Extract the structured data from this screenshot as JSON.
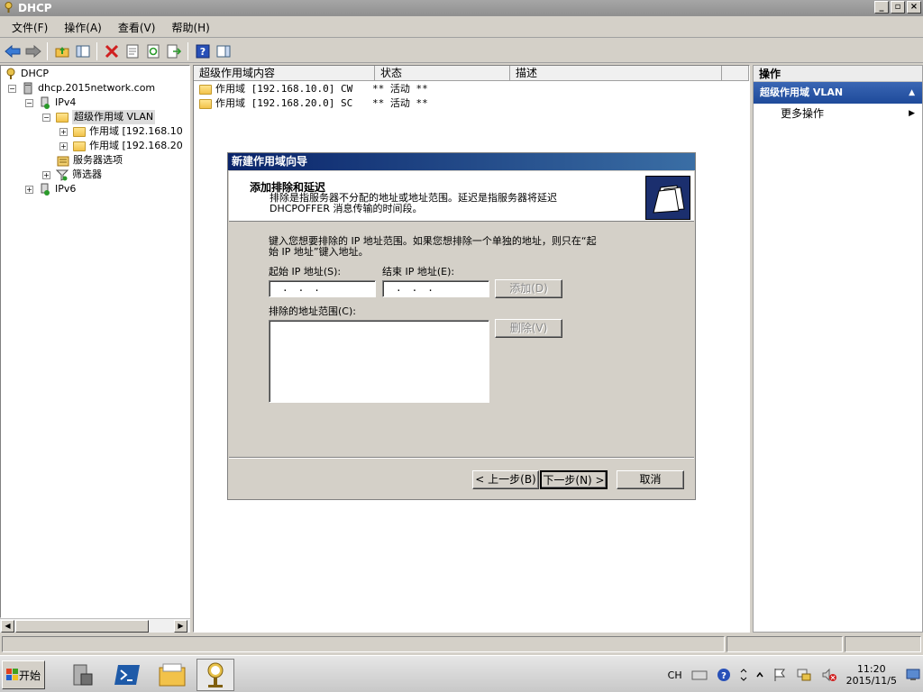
{
  "window": {
    "title": "DHCP",
    "btn_min": "_",
    "btn_max": "▫",
    "btn_close": "×"
  },
  "menu": [
    "文件(F)",
    "操作(A)",
    "查看(V)",
    "帮助(H)"
  ],
  "toolbar": {
    "icons": [
      "back-icon",
      "forward-icon",
      "up-folder-icon",
      "show-hide-tree-icon",
      "delete-icon",
      "properties-icon",
      "refresh-icon",
      "export-list-icon",
      "help-icon",
      "show-hide-action-icon"
    ]
  },
  "tree": {
    "root": "DHCP",
    "server": "dhcp.2015network.com",
    "ipv4": "IPv4",
    "superscope": "超级作用域 VLAN",
    "scope1": "作用域 [192.168.10",
    "scope2": "作用域 [192.168.20",
    "server_options": "服务器选项",
    "filters": "筛选器",
    "ipv6": "IPv6",
    "expand_minus": "−",
    "expand_plus": "+"
  },
  "list": {
    "columns": [
      "超级作用域内容",
      "状态",
      "描述"
    ],
    "rows": [
      {
        "name": "作用域 [192.168.10.0] CW",
        "status": "** 活动 **"
      },
      {
        "name": "作用域 [192.168.20.0] SC",
        "status": "** 活动 **"
      }
    ]
  },
  "actions": {
    "header": "操作",
    "selected": "超级作用域 VLAN",
    "more": "更多操作",
    "up_arrow": "▲",
    "more_arrow": "▶"
  },
  "dialog": {
    "title": "新建作用域向导",
    "heading": "添加排除和延迟",
    "subheading_line1": "排除是指服务器不分配的地址或地址范围。延迟是指服务器将延迟",
    "subheading_line2": "DHCPOFFER 消息传输的时间段。",
    "instruction_line1": "键入您想要排除的 IP 地址范围。如果您想排除一个单独的地址，则只在“起",
    "instruction_line2": "始 IP 地址”键入地址。",
    "start_ip_label": "起始 IP 地址(S):",
    "end_ip_label": "结束 IP 地址(E):",
    "start_ip_value": "...",
    "end_ip_value": "...",
    "add_button": "添加(D)",
    "excluded_label": "排除的地址范围(C):",
    "delete_button": "删除(V)",
    "back_button": "< 上一步(B)",
    "next_button": "下一步(N) >",
    "cancel_button": "取消"
  },
  "scrollbar": {
    "left": "◀",
    "right": "▶"
  },
  "taskbar": {
    "start": "开始",
    "tray_lang": "CH",
    "time": "11:20",
    "date": "2015/11/5",
    "apps": [
      "server-manager-icon",
      "powershell-icon",
      "explorer-icon",
      "dhcp-icon"
    ]
  },
  "colors": {
    "accent": "#1e4a9a",
    "dialog_title": "#0a246a"
  }
}
